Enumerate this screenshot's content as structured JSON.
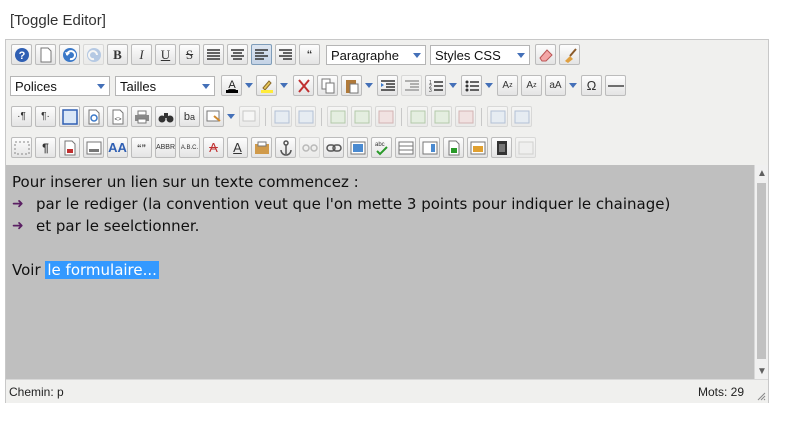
{
  "toggle_label": "[Toggle Editor]",
  "toolbar": {
    "format_select": "Paragraphe",
    "styles_select": "Styles CSS",
    "font_select": "Polices",
    "size_select": "Tailles"
  },
  "content": {
    "intro": "Pour inserer un lien sur un texte commencez :",
    "items": [
      "par le rediger (la convention veut que l'on mette 3 points pour indiquer le chainage)",
      "et par le seelctionner."
    ],
    "bullet": "➜",
    "link_prefix": "Voir",
    "selected_text": "le formulaire..."
  },
  "status": {
    "path": "Chemin: p",
    "words": "Mots: 29"
  },
  "colors": {
    "content_bg": "#bfbfbf",
    "selection": "#3399ff",
    "toolbar_bg": "#f0f0ee"
  }
}
